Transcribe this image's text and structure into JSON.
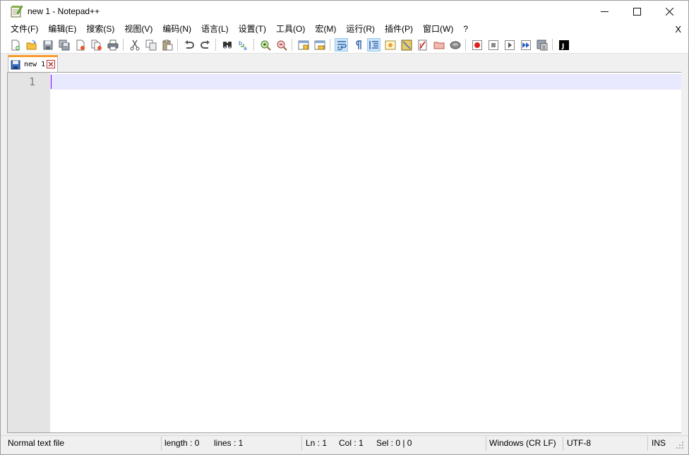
{
  "window": {
    "title": "new 1 - Notepad++",
    "minimize_glyph": "—",
    "maximize_glyph": "☐",
    "close_glyph": "✕"
  },
  "menu": {
    "items": [
      "文件(F)",
      "编辑(E)",
      "搜索(S)",
      "视图(V)",
      "编码(N)",
      "语言(L)",
      "设置(T)",
      "工具(O)",
      "宏(M)",
      "运行(R)",
      "插件(P)",
      "窗口(W)",
      "?"
    ],
    "close_label": "X"
  },
  "toolbar": {
    "icons": [
      "new-file-icon",
      "open-file-icon",
      "save-icon",
      "save-all-icon",
      "close-icon",
      "close-all-icon",
      "print-icon",
      "cut-icon",
      "copy-icon",
      "paste-icon",
      "undo-icon",
      "redo-icon",
      "find-icon",
      "replace-icon",
      "zoom-in-icon",
      "zoom-out-icon",
      "sync-vertical-icon",
      "sync-horizontal-icon",
      "word-wrap-icon",
      "show-all-chars-icon",
      "indent-guide-icon",
      "doc-map-icon",
      "function-list-icon",
      "folder-workspace-icon",
      "doc-list-icon",
      "monitoring-icon",
      "record-macro-icon",
      "stop-macro-icon",
      "play-macro-icon",
      "run-macro-multiple-icon",
      "save-macro-icon",
      "run-js-icon"
    ],
    "active": [
      "word-wrap-icon",
      "indent-guide-icon"
    ]
  },
  "tabs": [
    {
      "label": "new 1",
      "active": true
    }
  ],
  "editor": {
    "line_numbers": [
      "1"
    ],
    "content": ""
  },
  "statusbar": {
    "file_type": "Normal text file",
    "length": "length : 0",
    "lines": "lines : 1",
    "ln": "Ln : 1",
    "col": "Col : 1",
    "sel": "Sel : 0 | 0",
    "eol": "Windows (CR LF)",
    "encoding": "UTF-8",
    "mode": "INS"
  },
  "colors": {
    "tab_accent": "#fa9b2c",
    "current_line": "#e8e8ff",
    "caret": "#8000ff",
    "gutter": "#e4e4e4"
  }
}
